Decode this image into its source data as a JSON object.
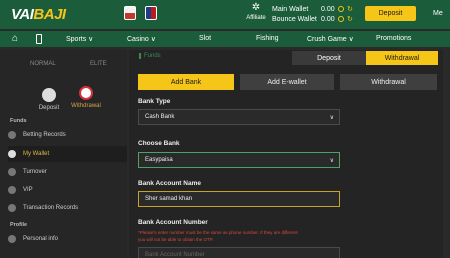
{
  "header": {
    "logo_main": "VAI",
    "logo_accent": "BAJI",
    "affiliate_label": "Affiliate",
    "main_wallet_label": "Main Wallet",
    "main_wallet_amount": "0.00",
    "bounce_wallet_label": "Bounce Wallet",
    "bounce_wallet_amount": "0.00",
    "deposit_label": "Deposit",
    "member_label": "Me"
  },
  "nav": {
    "items": [
      {
        "label": "Sports ∨"
      },
      {
        "label": "Casino ∨"
      },
      {
        "label": "Slot"
      },
      {
        "label": "Fishing"
      },
      {
        "label": "Crush Game ∨"
      },
      {
        "label": "Promotions"
      }
    ]
  },
  "sidebar": {
    "tabs": [
      {
        "label": "NORMAL"
      },
      {
        "label": "ELITE"
      }
    ],
    "actions": [
      {
        "label": "Deposit"
      },
      {
        "label": "Withdrawal"
      }
    ],
    "funds_header": "Funds",
    "profile_header": "Profile",
    "items": [
      {
        "label": "Betting Records"
      },
      {
        "label": "My Wallet"
      },
      {
        "label": "Turnover"
      },
      {
        "label": "VIP"
      },
      {
        "label": "Transaction Records"
      },
      {
        "label": "Personal info"
      }
    ]
  },
  "main": {
    "funds_title": "Funds",
    "deposit_tab": "Deposit",
    "withdrawal_tab": "Withdrawal",
    "subtabs": [
      {
        "label": "Add Bank"
      },
      {
        "label": "Add E-wallet"
      },
      {
        "label": "Withdrawal"
      }
    ],
    "bank_type_label": "Bank Type",
    "bank_type_value": "Cash Bank",
    "choose_bank_label": "Choose Bank",
    "choose_bank_value": "Easypaisa",
    "account_name_label": "Bank Account Name",
    "account_name_value": "Sher samad khan",
    "account_number_label": "Bank Account Number",
    "account_number_hint_1": "*Please's enter number must be the same as phone number. If they are different",
    "account_number_hint_2": "you will not be able to obtain the OTP.",
    "account_number_placeholder": "Bank Account Number"
  },
  "colors": {
    "header_green": "#1b5c3a",
    "accent_yellow": "#f5c518",
    "field_green": "#4aa35f",
    "hint_red": "#d84a3a"
  }
}
